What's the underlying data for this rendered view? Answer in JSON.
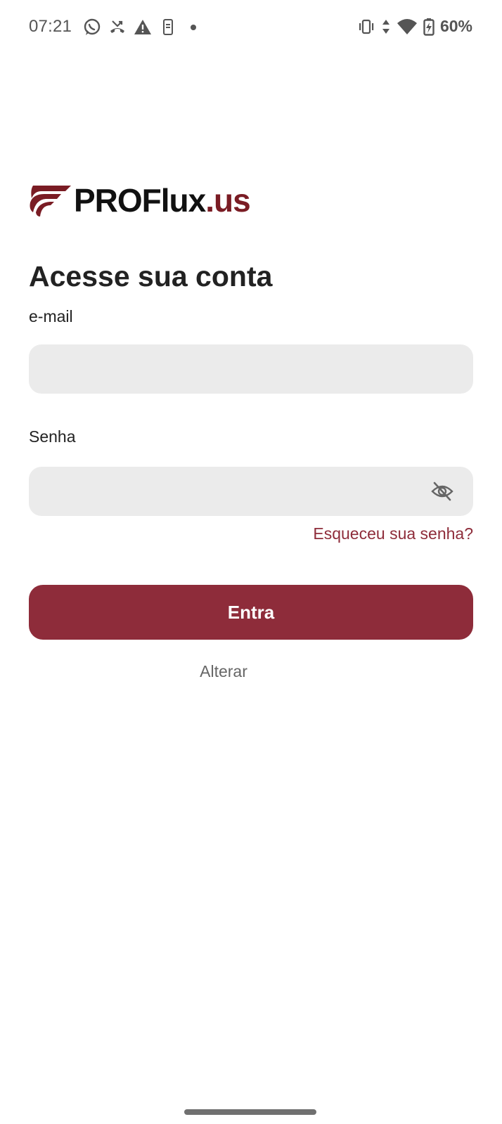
{
  "status_bar": {
    "time": "07:21",
    "left_icons": [
      "whatsapp-icon",
      "missed-call-icon",
      "warning-icon",
      "phone-icon",
      "dot-icon"
    ],
    "right_icons": [
      "vibrate-icon",
      "data-arrows-icon",
      "wifi-icon",
      "battery-charging-icon"
    ],
    "battery_percent": "60%"
  },
  "brand": {
    "name": "PROFlux",
    "tld": ".us",
    "logo_icon": "proflux-logo-icon",
    "color": "#7a1c24"
  },
  "login": {
    "title": "Acesse sua conta",
    "email_label": "e-mail",
    "email_value": "",
    "password_label": "Senha",
    "password_value": "",
    "password_toggle_icon": "eye-off-icon",
    "forgot_password": "Esqueceu sua senha?",
    "submit_label": "Entra",
    "alternate_link": "Alterar"
  },
  "colors": {
    "accent": "#8e2c3a",
    "field_bg": "#ebebeb"
  }
}
